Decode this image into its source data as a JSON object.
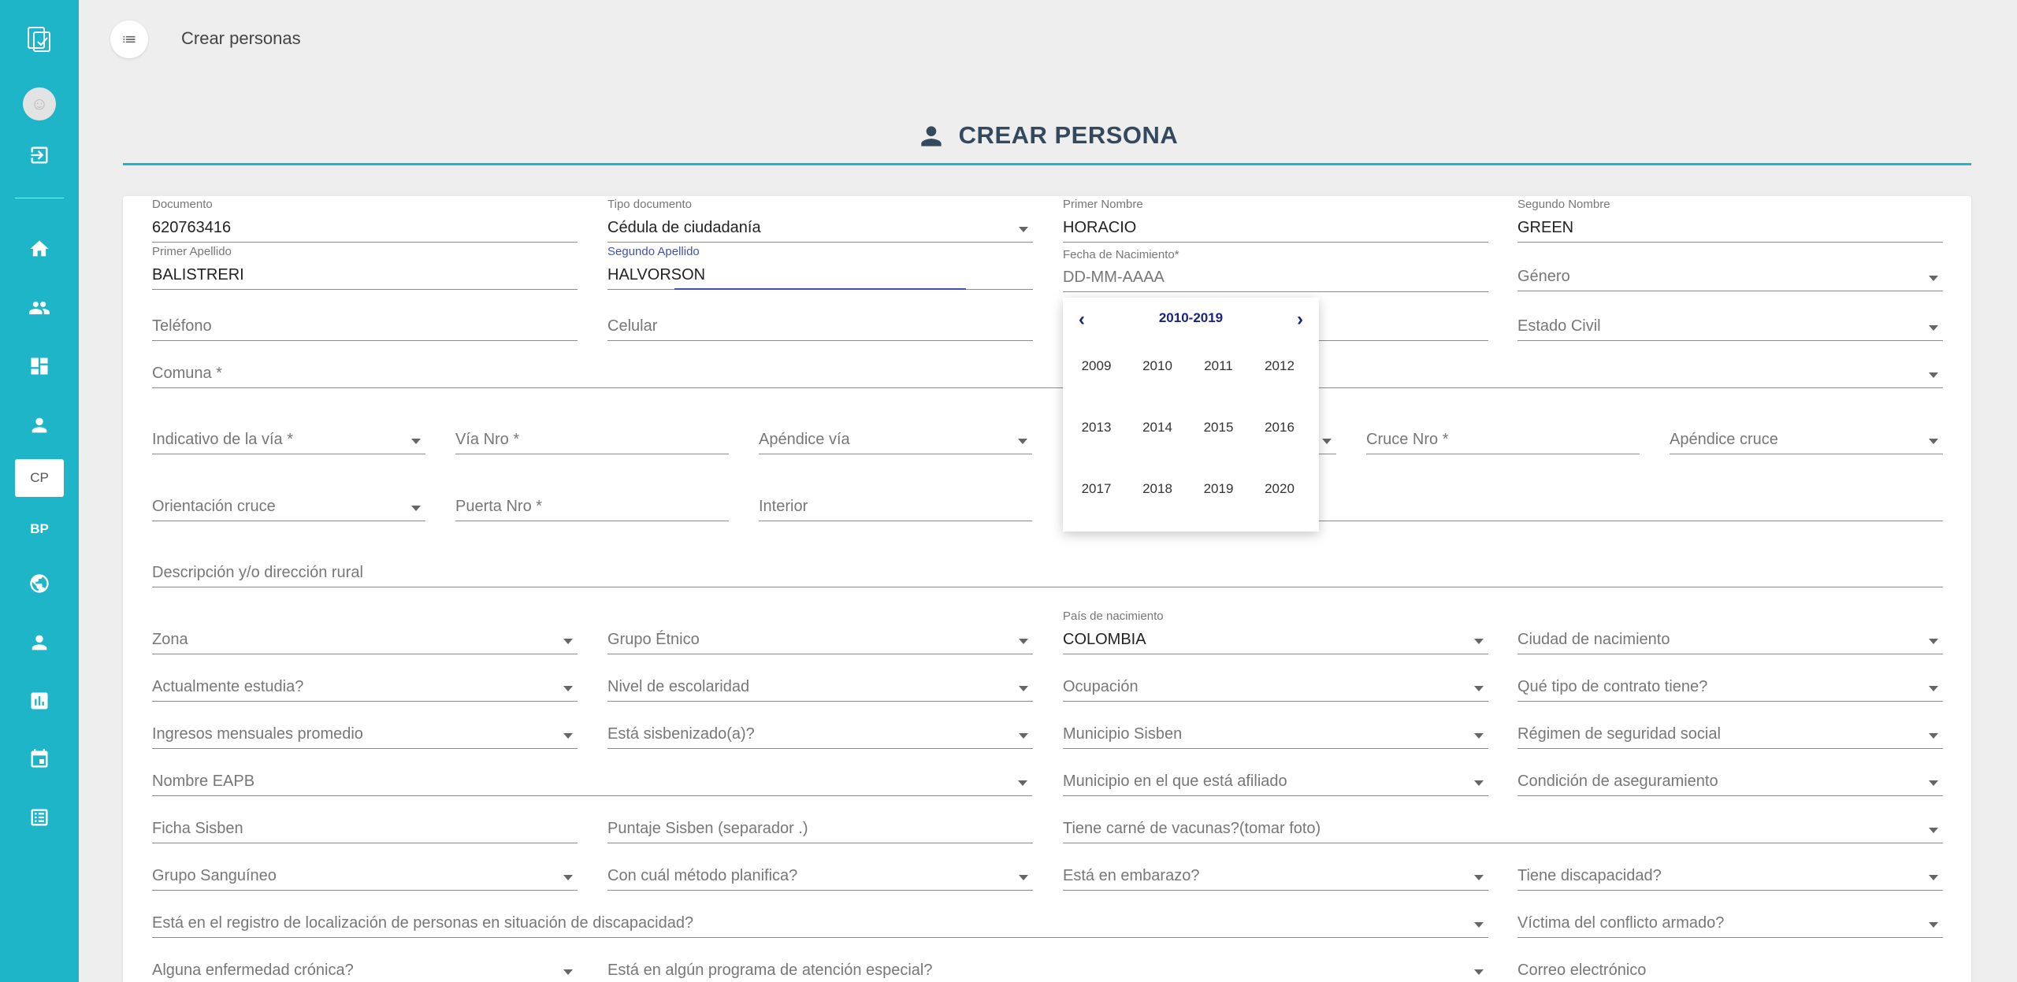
{
  "header": {
    "title": "Crear personas"
  },
  "page": {
    "heading": "CREAR PERSONA"
  },
  "sidebar": {
    "active_label": "CP",
    "bp_label": "BP"
  },
  "fields": {
    "documento": {
      "label": "Documento",
      "value": "620763416"
    },
    "tipo_documento": {
      "label": "Tipo documento",
      "value": "Cédula de ciudadanía"
    },
    "primer_nombre": {
      "label": "Primer Nombre",
      "value": "HORACIO"
    },
    "segundo_nombre": {
      "label": "Segundo Nombre",
      "value": "GREEN"
    },
    "primer_apellido": {
      "label": "Primer Apellido",
      "value": "BALISTRERI"
    },
    "segundo_apellido": {
      "label": "Segundo Apellido",
      "value": "HALVORSON"
    },
    "fecha_nacimiento": {
      "label": "Fecha de Nacimiento*",
      "placeholder": "DD-MM-AAAA"
    },
    "genero": {
      "placeholder": "Género"
    },
    "telefono": {
      "placeholder": "Teléfono"
    },
    "celular": {
      "placeholder": "Celular"
    },
    "estado_civil": {
      "placeholder": "Estado Civil"
    },
    "comuna": {
      "placeholder": "Comuna *"
    },
    "indicativo_via": {
      "placeholder": "Indicativo de la vía *"
    },
    "via_nro": {
      "placeholder": "Vía Nro *"
    },
    "apendice_via": {
      "placeholder": "Apéndice vía"
    },
    "cruce_nro": {
      "placeholder": "Cruce Nro *"
    },
    "apendice_cruce": {
      "placeholder": "Apéndice cruce"
    },
    "orientacion_cruce": {
      "placeholder": "Orientación cruce"
    },
    "puerta_nro": {
      "placeholder": "Puerta Nro *"
    },
    "interior": {
      "placeholder": "Interior"
    },
    "descripcion": {
      "placeholder": "Descripción y/o dirección rural"
    },
    "zona": {
      "placeholder": "Zona"
    },
    "grupo_etnico": {
      "placeholder": "Grupo Étnico"
    },
    "pais_nacimiento": {
      "label": "País de nacimiento",
      "value": "COLOMBIA"
    },
    "ciudad_nacimiento": {
      "placeholder": "Ciudad de nacimiento"
    },
    "actualmente_estudia": {
      "placeholder": "Actualmente estudia?"
    },
    "nivel_escolaridad": {
      "placeholder": "Nivel de escolaridad"
    },
    "ocupacion": {
      "placeholder": "Ocupación"
    },
    "tipo_contrato": {
      "placeholder": "Qué tipo de contrato tiene?"
    },
    "ingresos": {
      "placeholder": "Ingresos mensuales promedio"
    },
    "sisbenizado": {
      "placeholder": "Está sisbenizado(a)?"
    },
    "municipio_sisben": {
      "placeholder": "Municipio Sisben"
    },
    "regimen": {
      "placeholder": "Régimen de seguridad social"
    },
    "nombre_eapb": {
      "placeholder": "Nombre EAPB"
    },
    "municipio_afiliado": {
      "placeholder": "Municipio en el que está afiliado"
    },
    "condicion_aseguramiento": {
      "placeholder": "Condición de aseguramiento"
    },
    "ficha_sisben": {
      "placeholder": "Ficha Sisben"
    },
    "puntaje_sisben": {
      "placeholder": "Puntaje Sisben (separador .)"
    },
    "carne_vacunas": {
      "placeholder": "Tiene carné de vacunas?(tomar foto)"
    },
    "grupo_sanguineo": {
      "placeholder": "Grupo Sanguíneo"
    },
    "metodo_planifica": {
      "placeholder": "Con cuál método planifica?"
    },
    "embarazo": {
      "placeholder": "Está en embarazo?"
    },
    "discapacidad": {
      "placeholder": "Tiene discapacidad?"
    },
    "registro_discapacidad": {
      "placeholder": "Está en el registro de localización de personas en situación de discapacidad?"
    },
    "victima": {
      "placeholder": "Víctima del conflicto armado?"
    },
    "enfermedad_cronica": {
      "placeholder": "Alguna enfermedad crónica?"
    },
    "programa_especial": {
      "placeholder": "Está en algún programa de atención especial?"
    },
    "correo": {
      "placeholder": "Correo electrónico"
    }
  },
  "datepicker": {
    "title": "2010-2019",
    "prev": "‹",
    "next": "›",
    "years": [
      "2009",
      "2010",
      "2011",
      "2012",
      "2013",
      "2014",
      "2015",
      "2016",
      "2017",
      "2018",
      "2019",
      "2020"
    ]
  },
  "icons": {
    "sidebar": [
      "app-logo-icon",
      "avatar",
      "logout-icon",
      "home-icon",
      "people-icon",
      "dashboard-icon",
      "person-icon",
      "globe-icon",
      "person-icon",
      "bar-chart-icon",
      "calendar-icon",
      "list-icon"
    ],
    "heading": "person-icon",
    "menu": "list-icon"
  },
  "colors": {
    "sidebar": "#1fb5c9",
    "accent": "#3f51b5",
    "heading": "#34495e"
  }
}
